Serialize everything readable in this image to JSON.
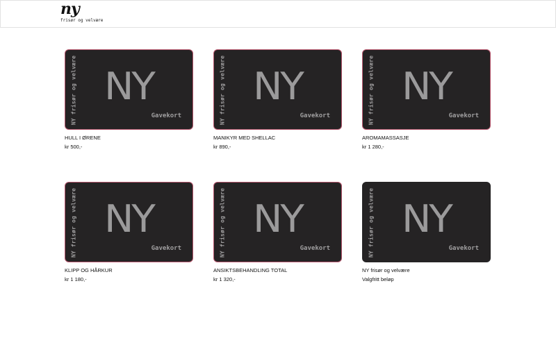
{
  "header": {
    "logo": "ny",
    "tagline": "frisør og velvære"
  },
  "card": {
    "side_text": "NY frisør og velvære",
    "big_text": "NY",
    "gavekort": "Gavekort"
  },
  "products": [
    {
      "name": "HULL I ØRENE",
      "price": "kr 500,-"
    },
    {
      "name": "MANIKYR MED SHELLAC",
      "price": "kr 890,-"
    },
    {
      "name": "AROMAMASSASJE",
      "price": "kr 1 280,-"
    },
    {
      "name": "KLIPP OG HÅRKUR",
      "price": "kr 1 180,-"
    },
    {
      "name": "ANSIKTSBEHANDLING TOTAL",
      "price": "kr 1 320,-"
    },
    {
      "name": "NY frisør og velvære",
      "price": "Valgfritt beløp"
    }
  ],
  "colors": {
    "card_bg": "#252324",
    "card_border": "#b8576e",
    "card_text": "#a09fa0"
  }
}
